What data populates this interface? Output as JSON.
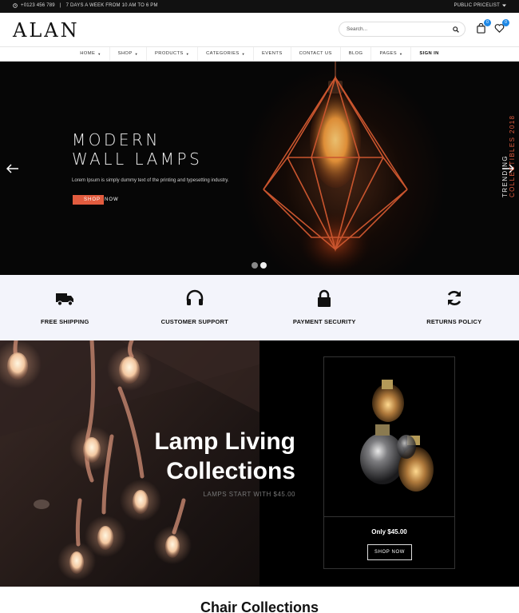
{
  "topbar": {
    "phone": "+0123 456 789",
    "hours": "7 DAYS A WEEK FROM 10 AM TO 6 PM",
    "pricelist": "PUBLIC PRICELIST",
    "clock_icon": "clock-icon",
    "caret_icon": "chevron-down-icon"
  },
  "header": {
    "logo": "ALAN",
    "search_placeholder": "Search...",
    "cart_count": "0",
    "wishlist_count": "0",
    "accent": "#1e88e5"
  },
  "nav": {
    "items": [
      {
        "label": "HOME",
        "caret": "▼"
      },
      {
        "label": "SHOP",
        "caret": "▼"
      },
      {
        "label": "PRODUCTS",
        "caret": "▼"
      },
      {
        "label": "CATEGORIES",
        "caret": "▼"
      },
      {
        "label": "EVENTS",
        "caret": ""
      },
      {
        "label": "CONTACT US",
        "caret": ""
      },
      {
        "label": "BLOG",
        "caret": ""
      },
      {
        "label": "PAGES",
        "caret": "▼"
      },
      {
        "label": "SIGN IN",
        "caret": ""
      }
    ]
  },
  "hero": {
    "title_line1": "MODERN",
    "title_line2": "WALL LAMPS",
    "subtitle": "Lorem Ipsum is simply dummy text of the printing and typesetting industry.",
    "button_part1": "SHOP ",
    "button_part2": "NOW",
    "side_line1": "TRENDING",
    "side_line2": "COLLECTIBLES 2018",
    "accent": "#e25c3f",
    "slides": 2,
    "active_slide": 2
  },
  "features": [
    {
      "label": "FREE SHIPPING",
      "icon": "truck-icon"
    },
    {
      "label": "CUSTOMER SUPPORT",
      "icon": "headset-icon"
    },
    {
      "label": "PAYMENT SECURITY",
      "icon": "lock-icon"
    },
    {
      "label": "RETURNS POLICY",
      "icon": "refresh-icon"
    }
  ],
  "banner": {
    "title_line1": "Lamp Living",
    "title_line2": "Collections",
    "subtitle": "LAMPS START WITH $45.00",
    "product_price": "Only $45.00",
    "product_button": "SHOP NOW"
  },
  "next_section": {
    "title": "Chair Collections"
  }
}
